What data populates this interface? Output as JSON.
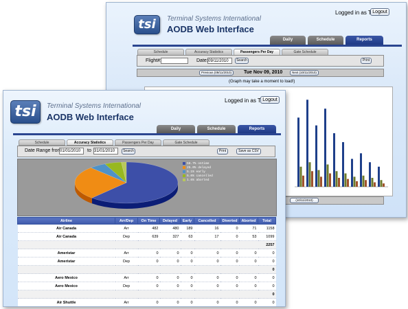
{
  "back_window": {
    "logo": "tsi",
    "company": "Terminal Systems International",
    "app_title": "AODB Web Interface",
    "logged_in": "Logged in as TSI",
    "logout": "Logout",
    "nav_tabs": [
      "Daily",
      "Schedule",
      "Reports"
    ],
    "active_nav": "Reports",
    "sub_tabs": [
      "Schedule",
      "Accuracy Statistics",
      "Passengers Per Day",
      "Gate Schedule"
    ],
    "active_sub": "Passengers Per Day",
    "flight_label": "Flight#:",
    "flight_value": "",
    "date_label": "Date:",
    "date_value": "09/11/2010",
    "search": "Search",
    "print": "Print",
    "previous": "Previous (08/11/2010)",
    "current_date": "Tue Nov 09, 2010",
    "next": "Next (10/11/2010)",
    "graph_note": "(Graph may take a moment to load!)",
    "bottom_next": "(10/11/2010)",
    "bar_colors": [
      "#1e3f8a",
      "#6b7a2a",
      "#a0522d"
    ],
    "bar_values": [
      [
        62,
        18,
        10
      ],
      [
        78,
        22,
        14
      ],
      [
        55,
        15,
        9
      ],
      [
        70,
        20,
        12
      ],
      [
        48,
        14,
        8
      ],
      [
        40,
        12,
        7
      ],
      [
        25,
        9,
        5
      ],
      [
        30,
        10,
        6
      ],
      [
        22,
        8,
        4
      ],
      [
        18,
        6,
        3
      ]
    ]
  },
  "front_window": {
    "logo": "tsi",
    "company": "Terminal Systems International",
    "app_title": "AODB Web Interface",
    "logged_in": "Logged in as TSI",
    "logout": "Logout",
    "nav_tabs": [
      "Daily",
      "Schedule",
      "Reports"
    ],
    "active_nav": "Reports",
    "sub_tabs": [
      "Schedule",
      "Accuracy Statistics",
      "Passengers Per Day",
      "Gate Schedule"
    ],
    "active_sub": "Accuracy Statistics",
    "range_label": "Date Range from",
    "from_value": "01/01/2010",
    "to_label": "to",
    "to_value": "31/01/2010",
    "search": "Search",
    "print": "Print",
    "save_csv": "Save as CSV",
    "chart_data": {
      "type": "pie",
      "categories": [
        "ontime",
        "delayed",
        "early",
        "cancelled",
        "aborted"
      ],
      "values": [
        58.7,
        25.0,
        5.0,
        5.0,
        1.5
      ],
      "legend_labels": [
        "58.7% ontime",
        "25.0% delayed",
        "5.1% early",
        "5.0% cancelled",
        "1.6% aborted"
      ],
      "colors": [
        "#3d4fa8",
        "#f08c14",
        "#4f92c8",
        "#98b820",
        "#b8c85c"
      ],
      "legend_position": "top-right"
    },
    "table": {
      "headers": [
        "Airline",
        "Arr/Dep",
        "On Time",
        "Delayed",
        "Early",
        "Cancelled",
        "Diverted",
        "Aborted",
        "Total"
      ],
      "rows": [
        {
          "type": "data",
          "cells": [
            "Air Canada",
            "Arr",
            "482",
            "480",
            "189",
            "16",
            "0",
            "71",
            "1158"
          ]
        },
        {
          "type": "data",
          "cells": [
            "Air Canada",
            "Dep",
            "639",
            "327",
            "63",
            "17",
            "0",
            "53",
            "1099"
          ]
        },
        {
          "type": "total",
          "cells": [
            "",
            "",
            "",
            "",
            "",
            "",
            "",
            "",
            "2257"
          ]
        },
        {
          "type": "data",
          "cells": [
            "Ameristar",
            "Arr",
            "0",
            "0",
            "0",
            "0",
            "0",
            "0",
            "0"
          ]
        },
        {
          "type": "data",
          "cells": [
            "Ameristar",
            "Dep",
            "0",
            "0",
            "0",
            "0",
            "0",
            "0",
            "0"
          ]
        },
        {
          "type": "total",
          "cells": [
            "",
            "",
            "",
            "",
            "",
            "",
            "",
            "",
            "0"
          ]
        },
        {
          "type": "data",
          "cells": [
            "Aero Mexico",
            "Arr",
            "0",
            "0",
            "0",
            "0",
            "0",
            "0",
            "0"
          ]
        },
        {
          "type": "data",
          "cells": [
            "Aero Mexico",
            "Dep",
            "0",
            "0",
            "0",
            "0",
            "0",
            "0",
            "0"
          ]
        },
        {
          "type": "total",
          "cells": [
            "",
            "",
            "",
            "",
            "",
            "",
            "",
            "",
            "0"
          ]
        },
        {
          "type": "data",
          "cells": [
            "Air Shuttle",
            "Arr",
            "0",
            "0",
            "0",
            "0",
            "0",
            "0",
            "0"
          ]
        }
      ]
    }
  }
}
